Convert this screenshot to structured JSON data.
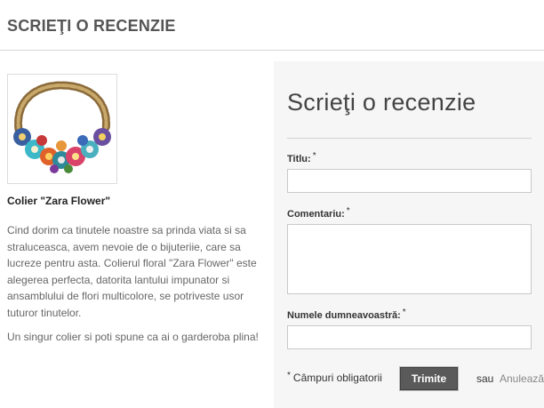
{
  "header": {
    "title": "SCRIEŢI O RECENZIE"
  },
  "product": {
    "name": "Colier \"Zara Flower\"",
    "image_icon": "necklace-image",
    "description": [
      "Cind dorim ca tinutele noastre sa prinda viata si sa straluceasca, avem nevoie de o bijuteriie, care sa lucreze pentru asta. Colierul floral \"Zara Flower\" este alegerea perfecta, datorita lantului impunator si ansamblului de flori multicolore, se potriveste usor tuturor tinutelor.",
      "Un singur colier si poti spune ca ai o garderoba plina!"
    ]
  },
  "form": {
    "title": "Scrieţi o recenzie",
    "fields": {
      "title": {
        "label": "Titlu:",
        "required_mark": "*",
        "value": ""
      },
      "comment": {
        "label": "Comentariu:",
        "required_mark": "*",
        "value": ""
      },
      "name": {
        "label": "Numele dumneavoastră:",
        "required_mark": "*",
        "value": ""
      }
    },
    "required_note_star": "*",
    "required_note": "Câmpuri obligatorii",
    "submit_label": "Trimite",
    "separator": "sau",
    "cancel_label": "Anulează"
  },
  "colors": {
    "panel_bg": "#f6f6f6",
    "button_bg": "#5a5a5a",
    "heading": "#555555"
  }
}
